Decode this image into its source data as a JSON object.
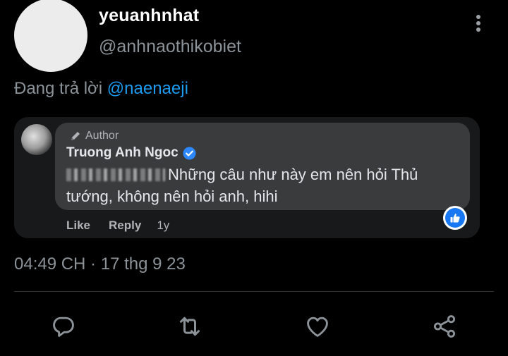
{
  "tweet": {
    "display_name": "yeuanhnhat",
    "handle": "@anhnaothikobiet",
    "reply_prefix": "Đang trả lời ",
    "reply_mention": "@naenaeji",
    "timestamp": "04:49 CH · 17 thg 9 23",
    "colors": {
      "background": "#000000",
      "muted": "#8b9298",
      "accent": "#1d9bf0"
    }
  },
  "embedded_comment": {
    "badge_label": "Author",
    "commenter_name": "Truong Anh Ngoc",
    "verified": true,
    "comment_text": "Những câu như này em nên hỏi Thủ tướng, không nên hỏi anh, hihi",
    "actions": {
      "like": "Like",
      "reply": "Reply",
      "age": "1y"
    },
    "reaction": "like-thumb-icon",
    "colors": {
      "card": "#18191a",
      "bubble": "#3a3b3c",
      "text": "#e4e6eb",
      "secondary": "#b0b3b8",
      "fb_blue": "#1877f2"
    }
  },
  "toolbar": {
    "icons": [
      "reply-icon",
      "retweet-icon",
      "like-heart-icon",
      "share-icon"
    ]
  }
}
